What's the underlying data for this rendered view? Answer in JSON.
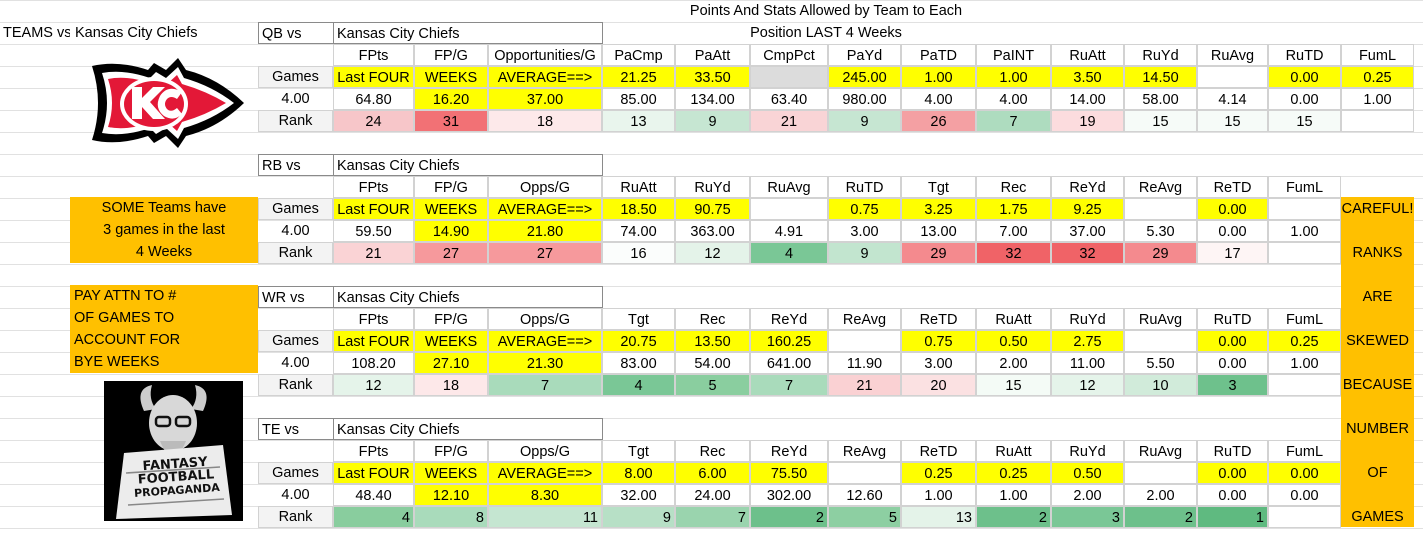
{
  "header": {
    "teams_vs": "TEAMS vs",
    "team": "Kansas City Chiefs",
    "title_line1": "Points And Stats Allowed by Team to Each",
    "title_line2": "Position LAST  4 Weeks"
  },
  "notes": {
    "left1": [
      "SOME Teams have",
      "3 games in the last",
      "4 Weeks"
    ],
    "left2": [
      "PAY ATTN TO #",
      "OF GAMES TO",
      "ACCOUNT FOR",
      "BYE WEEKS"
    ],
    "right": [
      "CAREFUL!",
      "RANKS",
      "ARE",
      "SKEWED",
      "BECAUSE",
      "NUMBER",
      "OF",
      "GAMES"
    ]
  },
  "logo_goat": {
    "line1": "FANTASY",
    "line2": "FOOTBALL",
    "line3": "PROPAGANDA"
  },
  "colors": {
    "yellow": "#ffff00",
    "orange": "#ffc000",
    "kc_red": "#e31837",
    "kc_gold": "#ffb612"
  },
  "sections": [
    {
      "label": "QB vs",
      "team": "Kansas City Chiefs",
      "headers": [
        "FPts",
        "FP/G",
        "Opportunities/G",
        "PaCmp",
        "PaAtt",
        "CmpPct",
        "PaYd",
        "PaTD",
        "PaINT",
        "RuAtt",
        "RuYd",
        "RuAvg",
        "RuTD",
        "FumL"
      ],
      "games_label": "Games",
      "games_row": [
        "Last FOUR",
        "WEEKS",
        "AVERAGE==>",
        "21.25",
        "33.50",
        "",
        "245.00",
        "1.00",
        "1.00",
        "3.50",
        "14.50",
        "",
        "0.00",
        "0.25"
      ],
      "totals_first": "4.00",
      "totals_row": [
        "64.80",
        "16.20",
        "37.00",
        "85.00",
        "134.00",
        "63.40",
        "980.00",
        "4.00",
        "4.00",
        "14.00",
        "58.00",
        "4.14",
        "0.00",
        "1.00"
      ],
      "rank_label": "Rank",
      "rank_row": [
        "24",
        "31",
        "18",
        "13",
        "9",
        "21",
        "9",
        "26",
        "7",
        "19",
        "15",
        "15",
        "15",
        ""
      ]
    },
    {
      "label": "RB vs",
      "team": "Kansas City Chiefs",
      "headers": [
        "FPts",
        "FP/G",
        "Opps/G",
        "RuAtt",
        "RuYd",
        "RuAvg",
        "RuTD",
        "Tgt",
        "Rec",
        "ReYd",
        "ReAvg",
        "ReTD",
        "FumL"
      ],
      "games_label": "Games",
      "games_row": [
        "Last FOUR",
        "WEEKS",
        "AVERAGE==>",
        "18.50",
        "90.75",
        "",
        "0.75",
        "3.25",
        "1.75",
        "9.25",
        "",
        "0.00",
        ""
      ],
      "totals_first": "4.00",
      "totals_row": [
        "59.50",
        "14.90",
        "21.80",
        "74.00",
        "363.00",
        "4.91",
        "3.00",
        "13.00",
        "7.00",
        "37.00",
        "5.30",
        "0.00",
        "1.00"
      ],
      "rank_label": "Rank",
      "rank_row": [
        "21",
        "27",
        "27",
        "16",
        "12",
        "4",
        "9",
        "29",
        "32",
        "32",
        "29",
        "17",
        ""
      ]
    },
    {
      "label": "WR vs",
      "team": "Kansas City Chiefs",
      "headers": [
        "FPts",
        "FP/G",
        "Opps/G",
        "Tgt",
        "Rec",
        "ReYd",
        "ReAvg",
        "ReTD",
        "RuAtt",
        "RuYd",
        "RuAvg",
        "RuTD",
        "FumL"
      ],
      "games_label": "Games",
      "games_row": [
        "Last FOUR",
        "WEEKS",
        "AVERAGE==>",
        "20.75",
        "13.50",
        "160.25",
        "",
        "0.75",
        "0.50",
        "2.75",
        "",
        "0.00",
        "0.25"
      ],
      "totals_first": "4.00",
      "totals_row": [
        "108.20",
        "27.10",
        "21.30",
        "83.00",
        "54.00",
        "641.00",
        "11.90",
        "3.00",
        "2.00",
        "11.00",
        "5.50",
        "0.00",
        "1.00"
      ],
      "rank_label": "Rank",
      "rank_row": [
        "12",
        "18",
        "7",
        "4",
        "5",
        "7",
        "21",
        "20",
        "15",
        "12",
        "10",
        "3",
        ""
      ]
    },
    {
      "label": "TE vs",
      "team": "Kansas City Chiefs",
      "headers": [
        "FPts",
        "FP/G",
        "Opps/G",
        "Tgt",
        "Rec",
        "ReYd",
        "ReAvg",
        "ReTD",
        "RuAtt",
        "RuYd",
        "RuAvg",
        "RuTD",
        "FumL"
      ],
      "games_label": "Games",
      "games_row": [
        "Last FOUR",
        "WEEKS",
        "AVERAGE==>",
        "8.00",
        "6.00",
        "75.50",
        "",
        "0.25",
        "0.25",
        "0.50",
        "",
        "0.00",
        "0.00"
      ],
      "totals_first": "4.00",
      "totals_row": [
        "48.40",
        "12.10",
        "8.30",
        "32.00",
        "24.00",
        "302.00",
        "12.60",
        "1.00",
        "1.00",
        "2.00",
        "2.00",
        "0.00",
        "0.00"
      ],
      "rank_label": "Rank",
      "rank_row": [
        "4",
        "8",
        "11",
        "9",
        "7",
        "2",
        "5",
        "13",
        "2",
        "3",
        "2",
        "1",
        ""
      ]
    }
  ]
}
